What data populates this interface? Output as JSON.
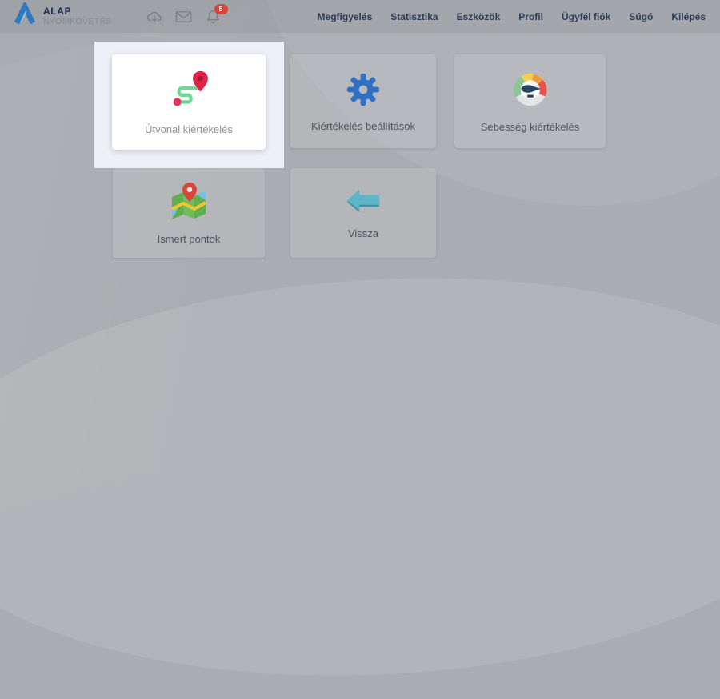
{
  "brand": {
    "name": "ALAP",
    "subtitle": "NYOMKÖVETÉS"
  },
  "header": {
    "notification_count": "5",
    "icons": [
      "cloud-download-icon",
      "mail-icon",
      "bell-icon"
    ],
    "nav_items": [
      {
        "label": "Megfigyelés"
      },
      {
        "label": "Statisztika"
      },
      {
        "label": "Eszközök"
      },
      {
        "label": "Profil"
      },
      {
        "label": "Ügyfél fiók"
      },
      {
        "label": "Súgó"
      },
      {
        "label": "Kilépés"
      }
    ]
  },
  "cards": [
    {
      "label": "Útvonal kiértékelés",
      "icon": "route-icon",
      "highlighted": true
    },
    {
      "label": "Kiértékelés beállítások",
      "icon": "gear-icon",
      "highlighted": false
    },
    {
      "label": "Sebesség kiértékelés",
      "icon": "speed-gauge-icon",
      "highlighted": false
    },
    {
      "label": "Ismert pontok",
      "icon": "map-pin-icon",
      "highlighted": false
    },
    {
      "label": "Vissza",
      "icon": "back-arrow-icon",
      "highlighted": false
    }
  ],
  "colors": {
    "page_bg": "#aaacb1",
    "accent_blue": "#2e75bd",
    "badge_red": "#d9453a",
    "route_green": "#72d794",
    "pin_red": "#e5345a",
    "gear_blue": "#2f70c2",
    "arrow_teal": "#55b4c6",
    "nav_text": "#2d3c56",
    "highlight_overlay": "#edf1f7"
  }
}
